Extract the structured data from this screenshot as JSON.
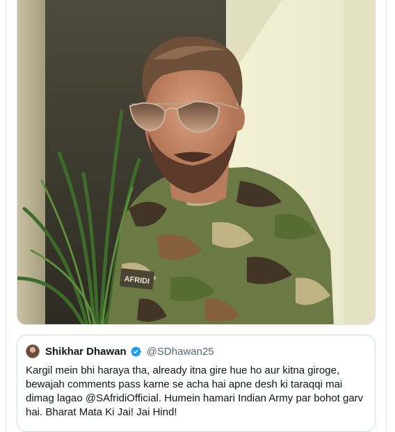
{
  "media": {
    "image_name": "photo-man-in-camouflage-shirt",
    "name_tag_text": "AFRIDI"
  },
  "quoted_tweet": {
    "author_name": "Shikhar Dhawan",
    "verified_icon": "verified-badge-icon",
    "handle": "@SDhawan25",
    "text": "Kargil mein bhi haraya tha, already itna gire hue ho aur kitna giroge,\nbewajah comments pass karne se acha hai apne desh ki taraqqi mai\ndimag lagao @SAfridiOfficial. Humein hamari Indian Army par bohot garv\nhai. Bharat Mata Ki Jai! Jai Hind!"
  },
  "colors": {
    "verified_blue": "#1d9bf0",
    "text_primary": "#0f1419",
    "text_secondary": "#536471",
    "border": "#cfd9de"
  }
}
